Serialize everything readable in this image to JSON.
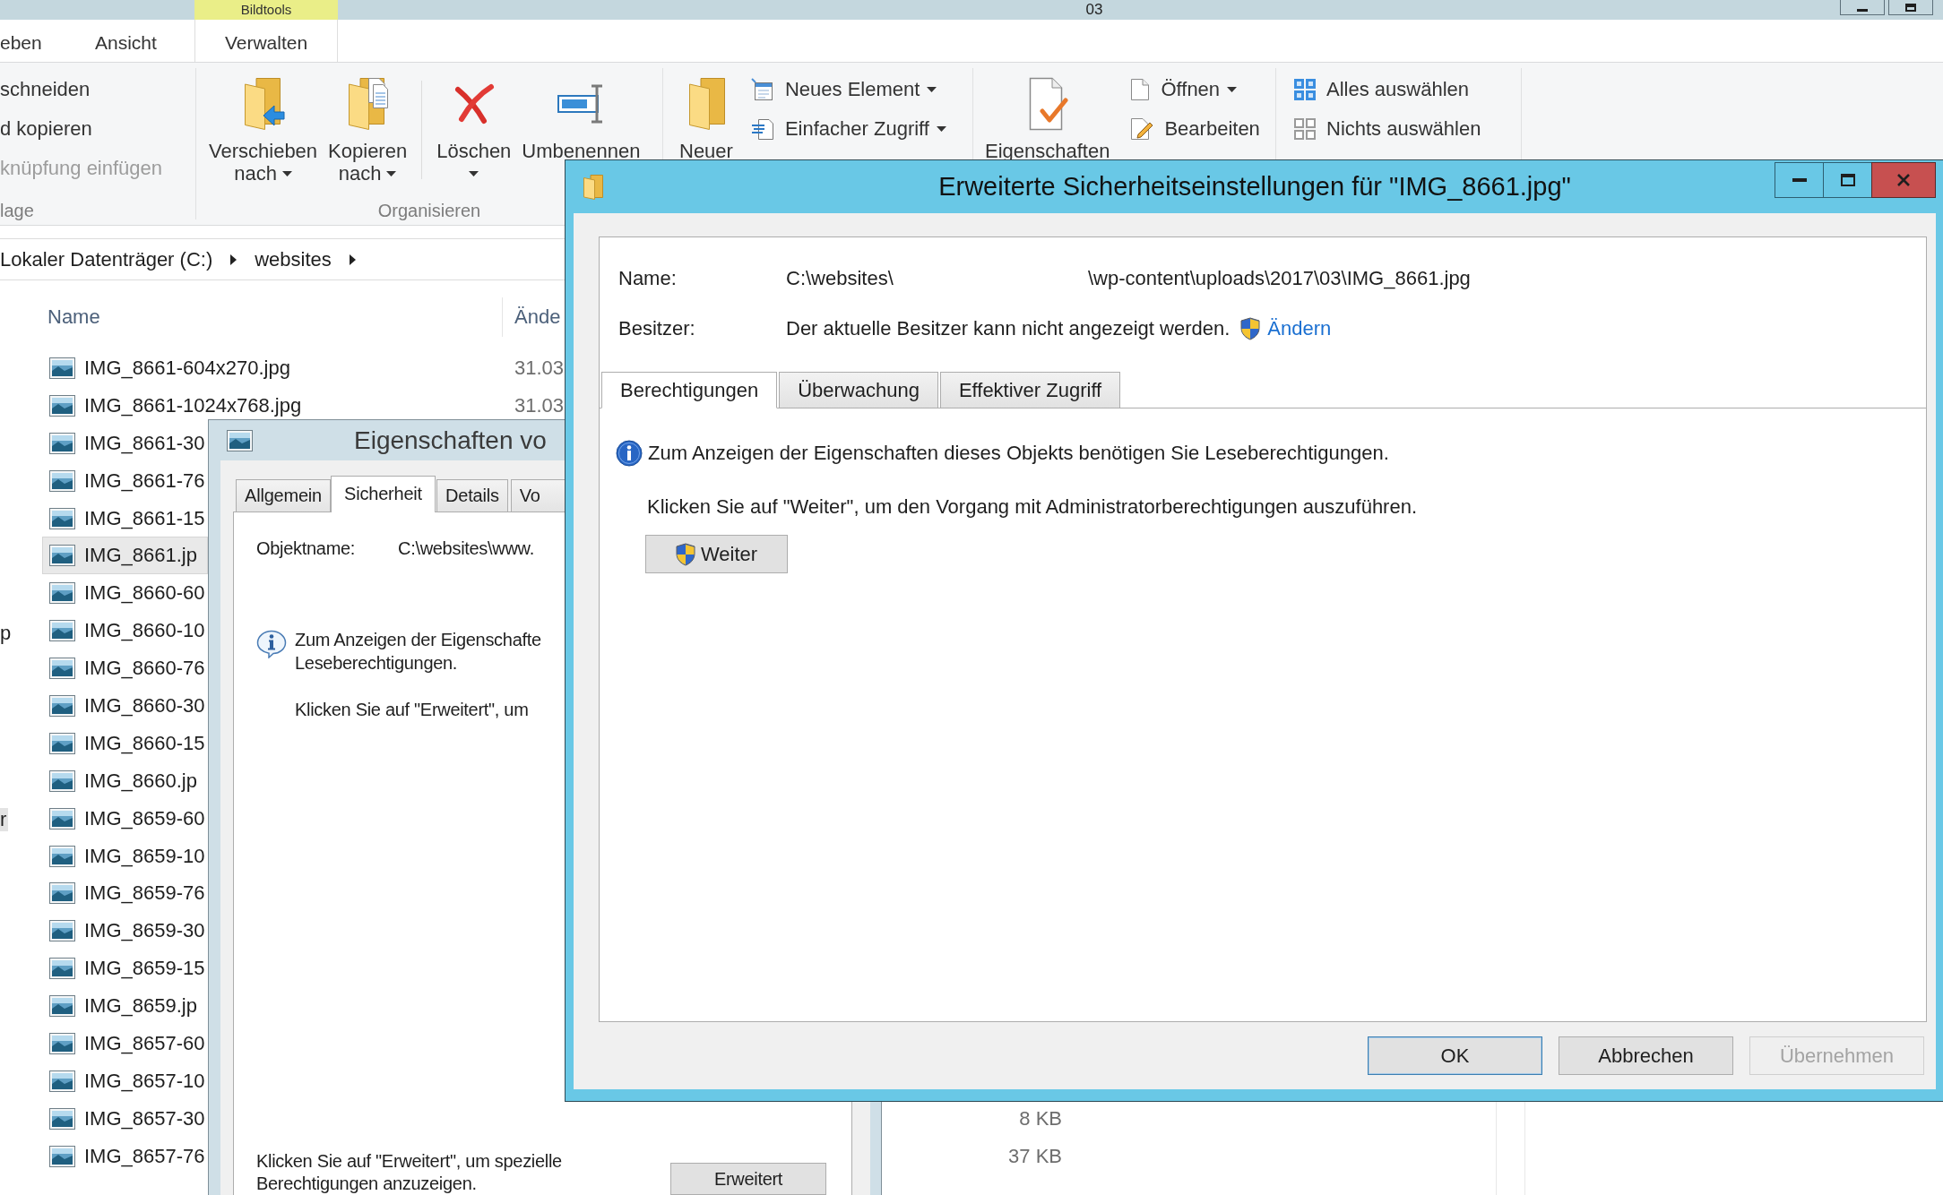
{
  "explorer": {
    "title": "03",
    "context_tab_group": "Bildtools",
    "ribbon_tabs": [
      {
        "label": "eben",
        "kind": "plain",
        "selected": false
      },
      {
        "label": "Ansicht",
        "kind": "plain",
        "selected": false
      },
      {
        "label": "Verwalten",
        "kind": "contextual",
        "selected": false
      }
    ],
    "ribbon_groups": [
      {
        "kind": "clipboard",
        "label": "lage",
        "items": [
          {
            "label": "schneiden",
            "disabled": false
          },
          {
            "label": "d kopieren",
            "disabled": false
          },
          {
            "label": "knüpfung einfügen",
            "disabled": true
          }
        ]
      },
      {
        "kind": "organize",
        "label": "Organisieren",
        "buttons": [
          {
            "lines": [
              "Verschieben",
              "nach"
            ],
            "dropdown": true
          },
          {
            "lines": [
              "Kopieren",
              "nach"
            ],
            "dropdown": true
          },
          {
            "lines": [
              "Löschen"
            ],
            "dropdown": true
          },
          {
            "lines": [
              "Umbenennen"
            ],
            "dropdown": false
          }
        ]
      },
      {
        "kind": "new",
        "large": {
          "lines": [
            "Neuer"
          ]
        },
        "items": [
          {
            "label": "Neues Element",
            "dropdown": true
          },
          {
            "label": "Einfacher Zugriff",
            "dropdown": true
          }
        ]
      },
      {
        "kind": "open",
        "large": {
          "lines": [
            "Eigenschaften"
          ]
        },
        "items": [
          {
            "label": "Öffnen",
            "dropdown": true
          },
          {
            "label": "Bearbeiten",
            "dropdown": false
          }
        ]
      },
      {
        "kind": "select",
        "items": [
          {
            "label": "Alles auswählen"
          },
          {
            "label": "Nichts auswählen"
          }
        ]
      }
    ],
    "breadcrumb": [
      "Lokaler Datenträger (C:)",
      "websites"
    ],
    "nav_pane": [
      {
        "label": "p",
        "selected": false
      },
      {
        "label": "r",
        "selected": true
      }
    ],
    "columns": [
      "Name",
      "Ände"
    ],
    "files": [
      {
        "name": "IMG_8661-604x270.jpg",
        "date": "31.03",
        "selected": false
      },
      {
        "name": "IMG_8661-1024x768.jpg",
        "date": "31.03",
        "selected": false
      },
      {
        "name": "IMG_8661-30",
        "selected": false
      },
      {
        "name": "IMG_8661-76",
        "selected": false
      },
      {
        "name": "IMG_8661-15",
        "selected": false
      },
      {
        "name": "IMG_8661.jp",
        "selected": true
      },
      {
        "name": "IMG_8660-60",
        "selected": false
      },
      {
        "name": "IMG_8660-10",
        "selected": false
      },
      {
        "name": "IMG_8660-76",
        "selected": false
      },
      {
        "name": "IMG_8660-30",
        "selected": false
      },
      {
        "name": "IMG_8660-15",
        "selected": false
      },
      {
        "name": "IMG_8660.jp",
        "selected": false
      },
      {
        "name": "IMG_8659-60",
        "selected": false
      },
      {
        "name": "IMG_8659-10",
        "selected": false
      },
      {
        "name": "IMG_8659-76",
        "selected": false
      },
      {
        "name": "IMG_8659-30",
        "selected": false
      },
      {
        "name": "IMG_8659-15",
        "selected": false
      },
      {
        "name": "IMG_8659.jp",
        "selected": false
      },
      {
        "name": "IMG_8657-60",
        "selected": false
      },
      {
        "name": "IMG_8657-10",
        "selected": false
      },
      {
        "name": "IMG_8657-30",
        "size": "8 KB",
        "selected": false
      },
      {
        "name": "IMG_8657-76",
        "size": "37 KB",
        "selected": false
      }
    ]
  },
  "properties_dialog": {
    "title": "Eigenschaften vo",
    "tabs": [
      {
        "label": "Allgemein",
        "selected": false
      },
      {
        "label": "Sicherheit",
        "selected": true
      },
      {
        "label": "Details",
        "selected": false
      },
      {
        "label": "Vo",
        "selected": false
      }
    ],
    "object_name": {
      "label": "Objektname:",
      "value": "C:\\websites\\www."
    },
    "info_lines": [
      "Zum Anzeigen der Eigenschafte",
      "Leseberechtigungen."
    ],
    "hint": "Klicken Sie auf \"Erweitert\", um",
    "note": "Klicken Sie auf \"Erweitert\", um spezielle Berechtigungen anzuzeigen.",
    "button": "Erweitert"
  },
  "security_dialog": {
    "title": "Erweiterte Sicherheitseinstellungen für \"IMG_8661.jpg\"",
    "name": {
      "label": "Name:",
      "value_parts": [
        "C:\\websites\\",
        "\\wp-content\\uploads\\2017\\03\\IMG_8661.jpg"
      ]
    },
    "owner": {
      "label": "Besitzer:",
      "value": "Der aktuelle Besitzer kann nicht angezeigt werden.",
      "link": "Ändern"
    },
    "tabs": [
      {
        "label": "Berechtigungen",
        "selected": true
      },
      {
        "label": "Überwachung",
        "selected": false
      },
      {
        "label": "Effektiver Zugriff",
        "selected": false
      }
    ],
    "info": "Zum Anzeigen der Eigenschaften dieses Objekts benötigen Sie Leseberechtigungen.",
    "hint": "Klicken Sie auf \"Weiter\", um den Vorgang mit Administratorberechtigungen auszuführen.",
    "continue_button": "Weiter",
    "buttons": [
      {
        "label": "OK",
        "default": true,
        "disabled": false
      },
      {
        "label": "Abbrechen",
        "default": false,
        "disabled": false
      },
      {
        "label": "Übernehmen",
        "default": false,
        "disabled": true
      }
    ]
  }
}
